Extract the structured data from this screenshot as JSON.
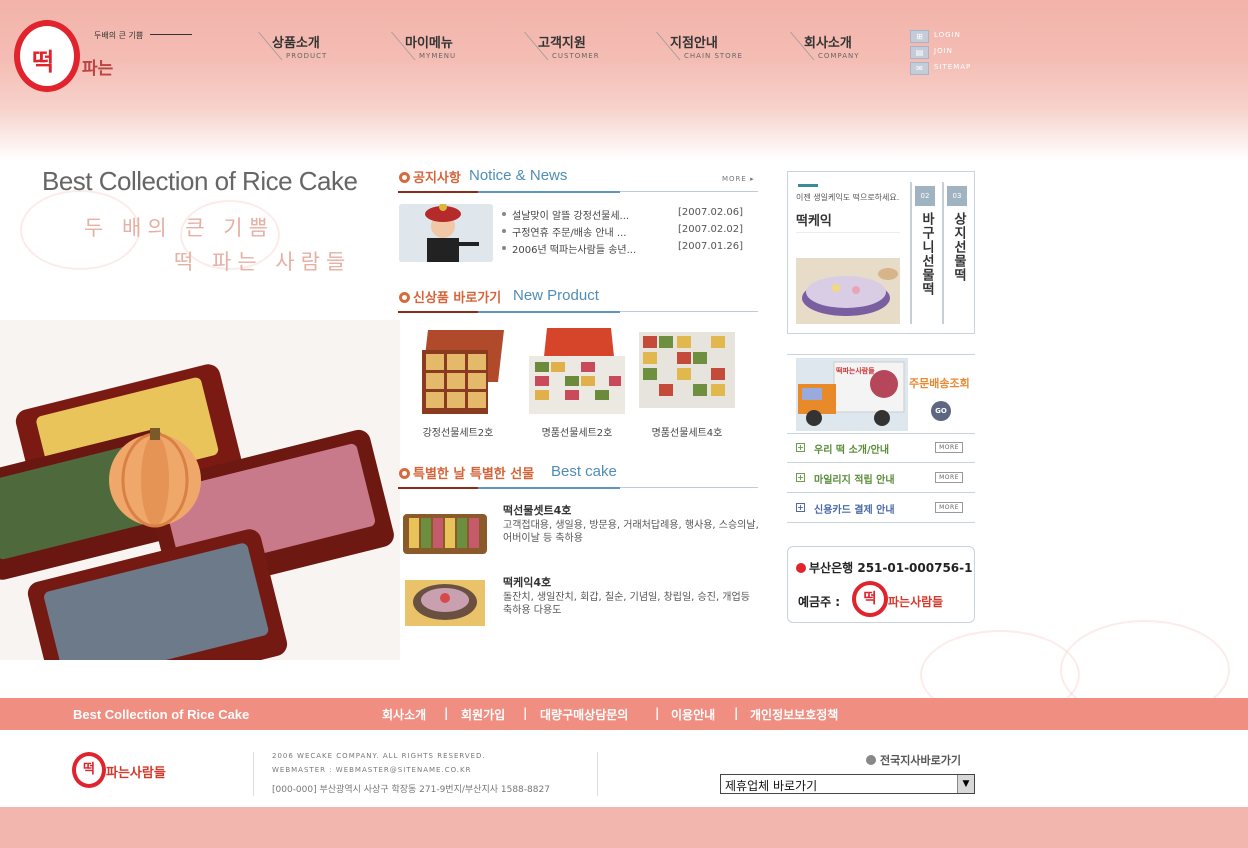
{
  "header": {
    "logo_text": "떡",
    "logo_sub": "파는",
    "slogan": "두배의 큰 기쁨",
    "gnb": [
      {
        "ko": "상품소개",
        "en": "PRODUCT"
      },
      {
        "ko": "마이메뉴",
        "en": "MYMENU"
      },
      {
        "ko": "고객지원",
        "en": "CUSTOMER"
      },
      {
        "ko": "지점안내",
        "en": "CHAIN STORE"
      },
      {
        "ko": "회사소개",
        "en": "COMPANY"
      }
    ],
    "util": [
      {
        "label": "LOGIN",
        "icon": "sitemap-tree-icon"
      },
      {
        "label": "JOIN",
        "icon": "document-icon"
      },
      {
        "label": "SITEMAP",
        "icon": "mail-icon"
      }
    ]
  },
  "visual": {
    "title": "Best Collection of Rice Cake",
    "line1": "두 배의 큰 기쁨",
    "line2": "떡 파는 사람들"
  },
  "notice": {
    "title_ko": "공지사항",
    "title_en": "Notice & News",
    "more": "MORE",
    "items": [
      {
        "title": "설날맞이 알뜰 강정선물세...",
        "date": "[2007.02.06]"
      },
      {
        "title": "구정연휴 주문/배송 안내 ...",
        "date": "[2007.02.02]"
      },
      {
        "title": "2006년 떡파는사람들 송년...",
        "date": "[2007.01.26]"
      }
    ]
  },
  "new_product": {
    "title_ko": "신상품 바로가기",
    "title_en": "New Product",
    "items": [
      {
        "caption": "강정선물세트2호"
      },
      {
        "caption": "명품선물세트2호"
      },
      {
        "caption": "명품선물세트4호"
      }
    ]
  },
  "best_cake": {
    "title_ko": "특별한 날 특별한 선물",
    "title_en": "Best cake",
    "items": [
      {
        "title": "떡선물셋트4호",
        "desc": "고객접대용, 생일용, 방문용, 거래처답례용, 행사용, 스승의날, 어버이날 등 축하용"
      },
      {
        "title": "떡케익4호",
        "desc": "돌잔치, 생일잔치, 회갑, 칠순, 기념일, 창립일, 승진, 개업등 축하용 다용도"
      }
    ]
  },
  "right": {
    "cake_caption": "이젠 생일케익도 떡으로하세요.",
    "cake_title": "떡케익",
    "tab2_num": "02",
    "tab2": "바구니선물떡",
    "tab3_num": "03",
    "tab3": "상지선물떡",
    "truck_label": "떡파는사람들",
    "delivery": "주문배송조회",
    "go": "GO",
    "links": [
      {
        "label": "우리 떡 소개/안내",
        "color": "#5a8c3a",
        "more": "MORE"
      },
      {
        "label": "마일리지 적립 안내",
        "color": "#5a8c3a",
        "more": "MORE"
      },
      {
        "label": "신용카드 결제 안내",
        "color": "#4a6aa8",
        "more": "MORE"
      }
    ],
    "bank_line": "부산은행  251-01-000756-1",
    "depositor": "예금주 :",
    "depositor_logo": "떡",
    "depositor_name": "파는사람들"
  },
  "footer": {
    "bar_title": "Best Collection of Rice Cake",
    "links": [
      "회사소개",
      "회원가입",
      "대량구매상담문의",
      "이용안내",
      "개인정보보호정책"
    ],
    "sep": "|",
    "logo": "떡",
    "logo_sub": "파는사람들",
    "copyright": "2006 WECAKE COMPANY. ALL RIGHTS RESERVED.",
    "webmaster": "WEBMASTER : WEBMASTER@SITENAME.CO.KR",
    "address": "[000-000] 부산광역시 사상구 학장동 271-9번지/부산지사 1588-8827",
    "branch_label": "전국지사바로가기",
    "select_value": "제휴업체 바로가기"
  }
}
